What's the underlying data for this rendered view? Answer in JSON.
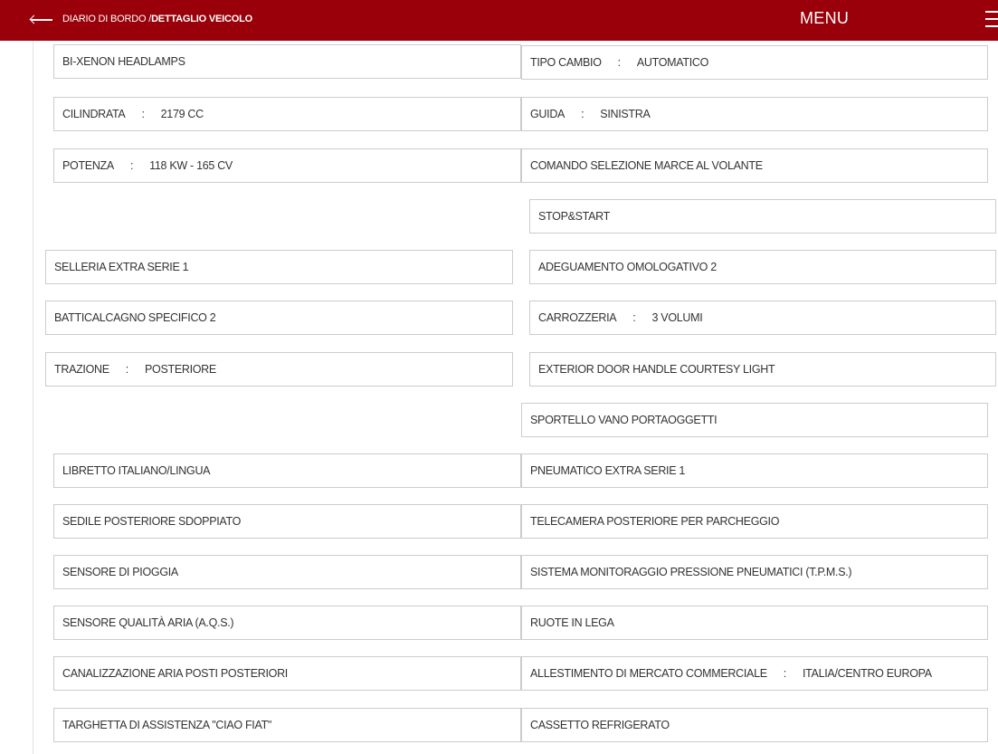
{
  "header": {
    "breadcrumb_parent": "DIARIO DI BORDO",
    "breadcrumb_separator": "/",
    "breadcrumb_current": "DETTAGLIO VEICOLO",
    "menu_label": "MENU"
  },
  "features": [
    {
      "label": "BI-XENON HEADLAMPS"
    },
    {
      "label": "TIPO CAMBIO",
      "value": "AUTOMATICO"
    },
    {
      "label": "CILINDRATA",
      "value": "2179 CC"
    },
    {
      "label": "GUIDA",
      "value": "SINISTRA"
    },
    {
      "label": "POTENZA",
      "value": "118 KW - 165 CV"
    },
    {
      "label": "COMANDO SELEZIONE MARCE AL VOLANTE"
    },
    {
      "label": "STOP&START"
    },
    {
      "label": "SELLERIA EXTRA SERIE 1"
    },
    {
      "label": "ADEGUAMENTO OMOLOGATIVO 2"
    },
    {
      "label": "BATTICALCAGNO SPECIFICO 2"
    },
    {
      "label": "CARROZZERIA",
      "value": "3 VOLUMI"
    },
    {
      "label": "TRAZIONE",
      "value": "POSTERIORE"
    },
    {
      "label": "EXTERIOR DOOR HANDLE COURTESY LIGHT"
    },
    {
      "label": "SPORTELLO VANO PORTAOGGETTI"
    },
    {
      "label": "LIBRETTO ITALIANO/LINGUA"
    },
    {
      "label": "PNEUMATICO EXTRA SERIE 1"
    },
    {
      "label": "SEDILE POSTERIORE SDOPPIATO"
    },
    {
      "label": "TELECAMERA POSTERIORE PER PARCHEGGIO"
    },
    {
      "label": "SENSORE DI PIOGGIA"
    },
    {
      "label": "SISTEMA MONITORAGGIO PRESSIONE PNEUMATICI (T.P.M.S.)"
    },
    {
      "label": "SENSORE QUALITÀ ARIA (A.Q.S.)"
    },
    {
      "label": "RUOTE IN LEGA"
    },
    {
      "label": "CANALIZZAZIONE ARIA POSTI POSTERIORI"
    },
    {
      "label": "ALLESTIMENTO DI MERCATO COMMERCIALE",
      "value": "ITALIA/CENTRO EUROPA"
    },
    {
      "label": "TARGHETTA DI ASSISTENZA \"CIAO FIAT\""
    },
    {
      "label": "CASSETTO REFRIGERATO"
    }
  ],
  "colors": {
    "header_bg": "#990009",
    "header_text": "#ffffff",
    "box_border": "#cccccc",
    "text": "#333333"
  },
  "icons": {
    "back": "back-arrow-icon",
    "menu": "hamburger-menu-icon"
  }
}
